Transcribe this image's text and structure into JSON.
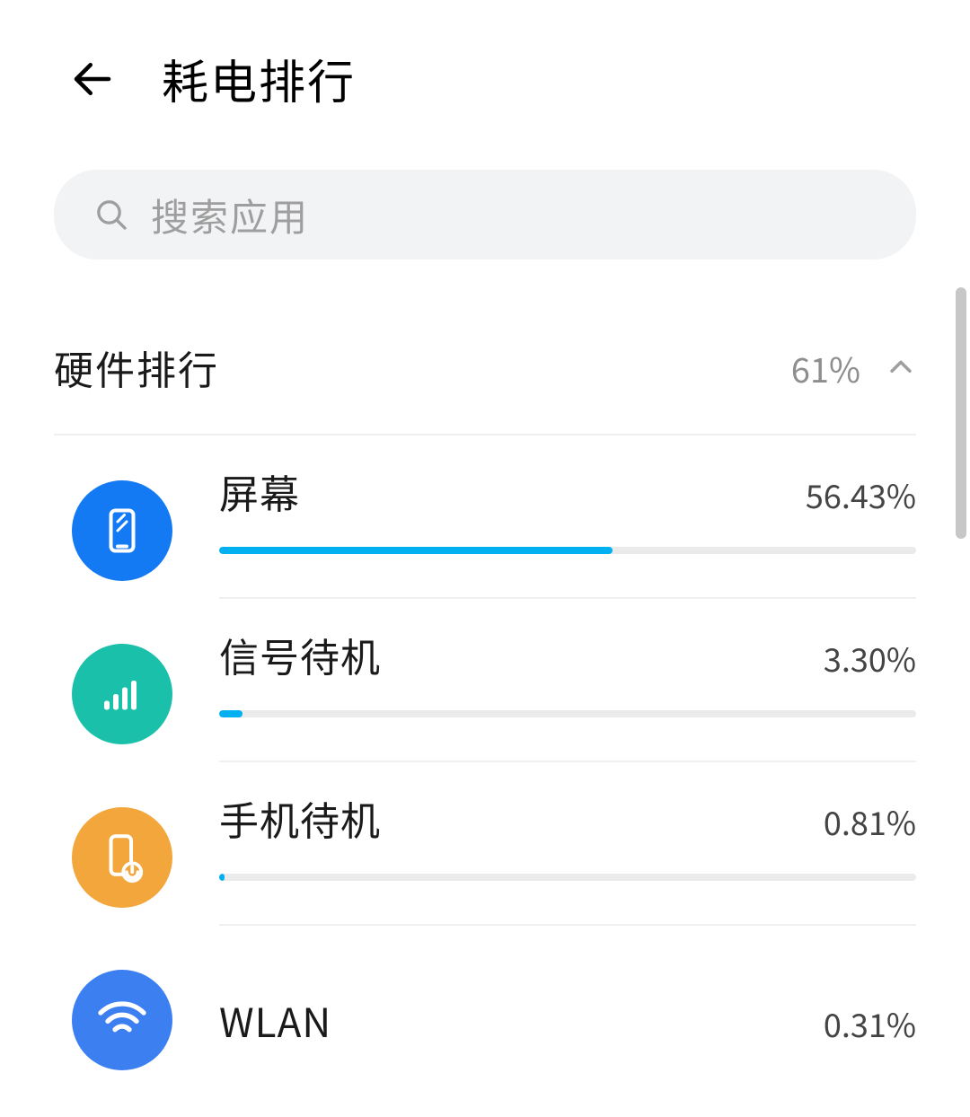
{
  "header": {
    "title": "耗电排行"
  },
  "search": {
    "placeholder": "搜索应用"
  },
  "section": {
    "title": "硬件排行",
    "percent": "61%"
  },
  "items": [
    {
      "name": "屏幕",
      "percent": "56.43%",
      "progress": 56.43
    },
    {
      "name": "信号待机",
      "percent": "3.30%",
      "progress": 3.3
    },
    {
      "name": "手机待机",
      "percent": "0.81%",
      "progress": 0.81
    },
    {
      "name": "WLAN",
      "percent": "0.31%",
      "progress": 0.31
    }
  ]
}
